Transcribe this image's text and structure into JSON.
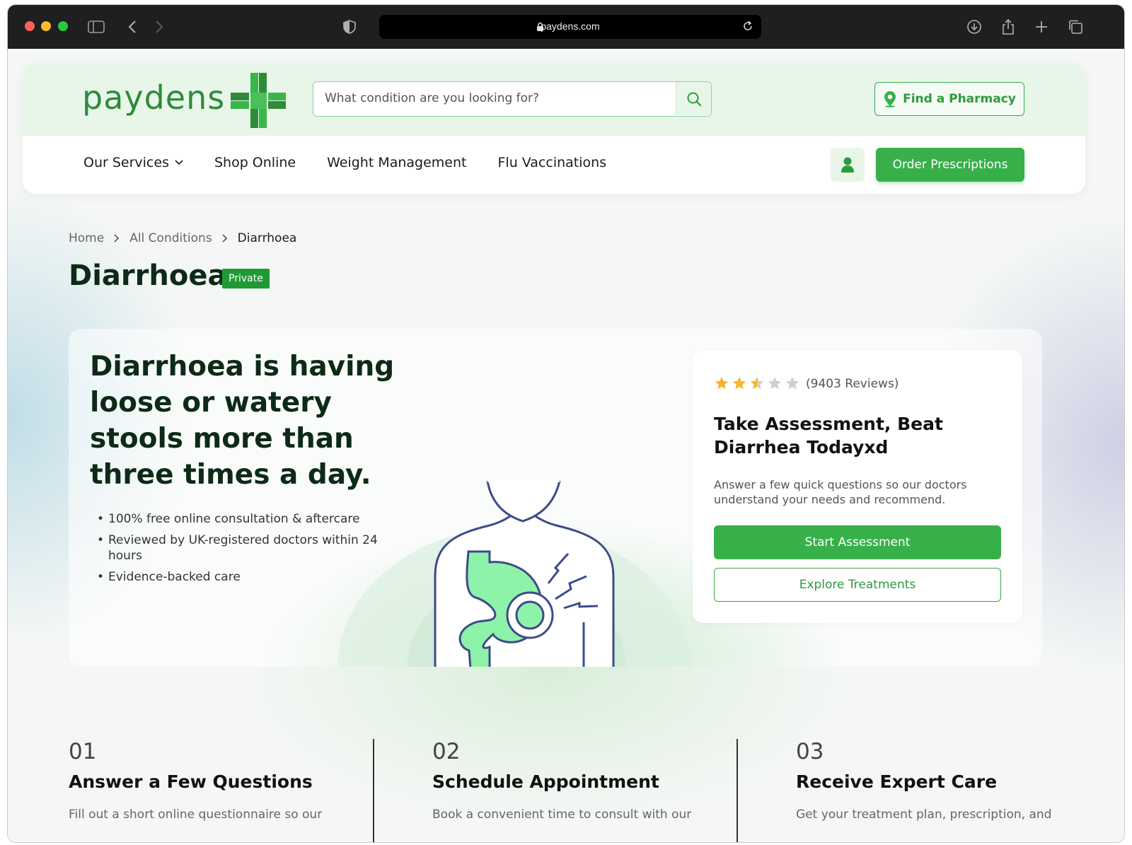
{
  "browser": {
    "url": "paydens.com"
  },
  "header": {
    "logo_text": "paydens",
    "search_placeholder": "What condition are you looking for?",
    "find_pharmacy_label": "Find a Pharmacy",
    "nav": [
      {
        "label": "Our Services"
      },
      {
        "label": "Shop Online"
      },
      {
        "label": "Weight Management"
      },
      {
        "label": "Flu Vaccinations"
      }
    ],
    "order_label": "Order Prescriptions"
  },
  "breadcrumb": {
    "home": "Home",
    "all_conditions": "All Conditions",
    "current": "Diarrhoea"
  },
  "title": {
    "text": "Diarrhoea",
    "badge": "Private"
  },
  "hero": {
    "heading": "Diarrhoea is having loose or watery stools more than three times a day.",
    "bullets": [
      "100% free online consultation & aftercare",
      "Reviewed by UK-registered doctors within 24 hours",
      "Evidence-backed care"
    ]
  },
  "assessment_card": {
    "rating": 2.5,
    "rating_max": 5,
    "reviews": "(9403 Reviews)",
    "title": "Take Assessment, Beat Diarrhea Todayxd",
    "description": "Answer a few quick questions so our doctors understand your needs and recommend.",
    "start_label": "Start Assessment",
    "explore_label": "Explore Treatments"
  },
  "steps": [
    {
      "number": "01",
      "title": "Answer a Few Questions",
      "description": "Fill out a short online questionnaire so our"
    },
    {
      "number": "02",
      "title": "Schedule Appointment",
      "description": "Book a convenient time to consult with our"
    },
    {
      "number": "03",
      "title": "Receive Expert Care",
      "description": "Get your treatment plan, prescription, and"
    }
  ],
  "colors": {
    "brand_green": "#38b04a",
    "header_tint": "#e8f6e9",
    "badge_green": "#1e9a35",
    "star": "#f6b626"
  },
  "icons": [
    "sidebar-icon",
    "back-icon",
    "forward-icon",
    "shield-icon",
    "lock-icon",
    "reload-icon",
    "download-icon",
    "share-icon",
    "new-tab-icon",
    "tabs-icon",
    "search-icon",
    "map-pin-icon",
    "chevron-down-icon",
    "user-icon",
    "chevron-right-icon",
    "star-icon"
  ]
}
